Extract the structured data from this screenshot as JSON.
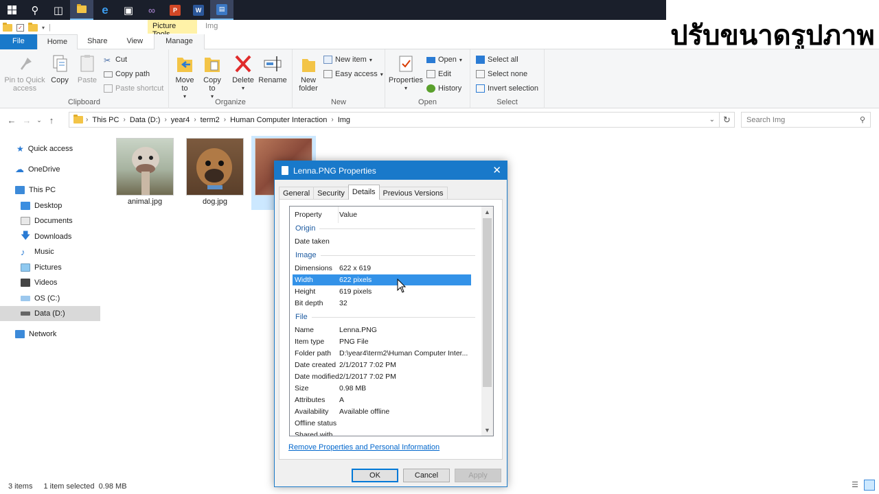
{
  "overlay_title": "ปรับขนาดรูปภาพ",
  "colors": {
    "accent": "#1979ca",
    "highlight": "#3392e8",
    "taskbar": "#1a1f2b",
    "selected_tile": "#cce8ff",
    "context_tab": "#fff2a8"
  },
  "taskbar": {
    "icons": [
      "windows-start-icon",
      "search-icon",
      "task-view-icon",
      "file-explorer-icon",
      "edge-icon",
      "store-icon",
      "visual-studio-icon",
      "powerpoint-icon",
      "word-icon",
      "document-app-icon"
    ],
    "ppt_badge": "P",
    "word_badge": "W"
  },
  "context_tabs": {
    "picture_tools": "Picture Tools",
    "folder_name": "Img"
  },
  "ribbon_tabs": {
    "file": "File",
    "home": "Home",
    "share": "Share",
    "view": "View",
    "manage": "Manage"
  },
  "ribbon": {
    "clipboard": {
      "label": "Clipboard",
      "pin": "Pin to Quick access",
      "copy": "Copy",
      "paste": "Paste",
      "cut": "Cut",
      "copy_path": "Copy path",
      "paste_shortcut": "Paste shortcut"
    },
    "organize": {
      "label": "Organize",
      "move_to": "Move to",
      "copy_to": "Copy to",
      "delete": "Delete",
      "rename": "Rename"
    },
    "new": {
      "label": "New",
      "new_folder": "New folder",
      "new_item": "New item",
      "easy_access": "Easy access"
    },
    "open": {
      "label": "Open",
      "properties": "Properties",
      "open": "Open",
      "edit": "Edit",
      "history": "History"
    },
    "select": {
      "label": "Select",
      "select_all": "Select all",
      "select_none": "Select none",
      "invert": "Invert selection"
    }
  },
  "address": {
    "crumbs": [
      "This PC",
      "Data (D:)",
      "year4",
      "term2",
      "Human Computer Interaction",
      "Img"
    ],
    "search_placeholder": "Search Img"
  },
  "navpane": {
    "quick_access": "Quick access",
    "onedrive": "OneDrive",
    "this_pc": "This PC",
    "desktop": "Desktop",
    "documents": "Documents",
    "downloads": "Downloads",
    "music": "Music",
    "pictures": "Pictures",
    "videos": "Videos",
    "os_c": "OS (C:)",
    "data_d": "Data (D:)",
    "network": "Network"
  },
  "files": [
    {
      "name": "animal.jpg"
    },
    {
      "name": "dog.jpg"
    },
    {
      "name": "Le"
    }
  ],
  "status": {
    "items": "3 items",
    "selected": "1 item selected  0.98 MB"
  },
  "dialog": {
    "title": "Lenna.PNG Properties",
    "tabs": {
      "general": "General",
      "security": "Security",
      "details": "Details",
      "previous": "Previous Versions"
    },
    "header": {
      "property": "Property",
      "value": "Value"
    },
    "sections": {
      "origin": "Origin",
      "image": "Image",
      "file": "File"
    },
    "rows": {
      "date_taken": {
        "k": "Date taken",
        "v": ""
      },
      "dimensions": {
        "k": "Dimensions",
        "v": "622 x 619"
      },
      "width": {
        "k": "Width",
        "v": "622 pixels"
      },
      "height": {
        "k": "Height",
        "v": "619 pixels"
      },
      "bit_depth": {
        "k": "Bit depth",
        "v": "32"
      },
      "name": {
        "k": "Name",
        "v": "Lenna.PNG"
      },
      "item_type": {
        "k": "Item type",
        "v": "PNG File"
      },
      "folder_path": {
        "k": "Folder path",
        "v": "D:\\year4\\term2\\Human Computer Inter..."
      },
      "date_created": {
        "k": "Date created",
        "v": "2/1/2017 7:02 PM"
      },
      "date_modified": {
        "k": "Date modified",
        "v": "2/1/2017 7:02 PM"
      },
      "size": {
        "k": "Size",
        "v": "0.98 MB"
      },
      "attributes": {
        "k": "Attributes",
        "v": "A"
      },
      "availability": {
        "k": "Availability",
        "v": "Available offline"
      },
      "offline_status": {
        "k": "Offline status",
        "v": ""
      },
      "shared_with": {
        "k": "Shared with",
        "v": ""
      }
    },
    "remove_link": "Remove Properties and Personal Information",
    "ok": "OK",
    "cancel": "Cancel",
    "apply": "Apply"
  }
}
